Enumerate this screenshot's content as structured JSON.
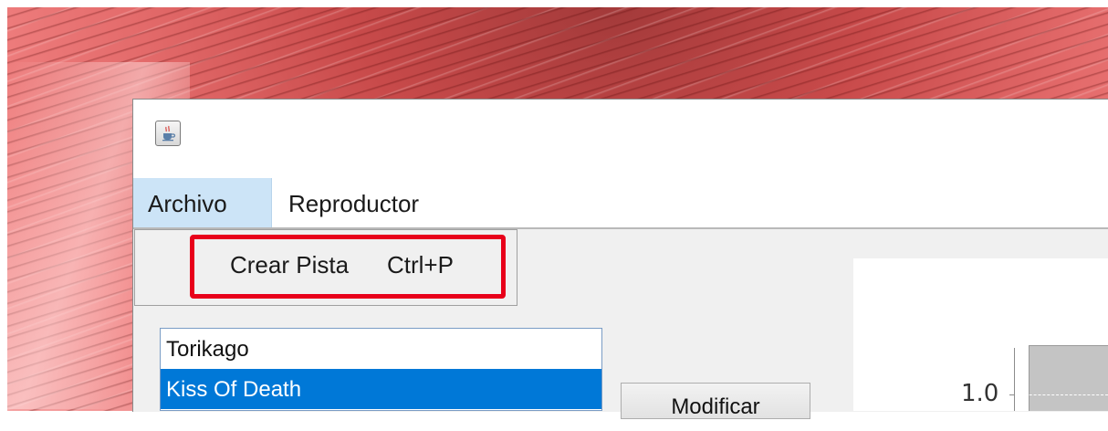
{
  "menubar": {
    "items": [
      {
        "label": "Archivo",
        "active": true
      },
      {
        "label": "Reproductor",
        "active": false
      }
    ]
  },
  "archivo_menu": {
    "items": [
      {
        "label": "Crear Pista",
        "shortcut": "Ctrl+P"
      }
    ]
  },
  "tracks": {
    "items": [
      {
        "label": "Torikago",
        "selected": false
      },
      {
        "label": "Kiss Of Death",
        "selected": true
      }
    ]
  },
  "buttons": {
    "modify_label": "Modificar"
  },
  "chart": {
    "y_tick_label": "1.0"
  },
  "chart_data": {
    "type": "bar",
    "yticks": [
      "1.0"
    ]
  },
  "colors": {
    "highlight_border": "#e8001a",
    "selection": "#0078d7",
    "menu_active": "#cce4f7"
  },
  "icons": {
    "app_icon": "java-coffee-cup-icon"
  }
}
